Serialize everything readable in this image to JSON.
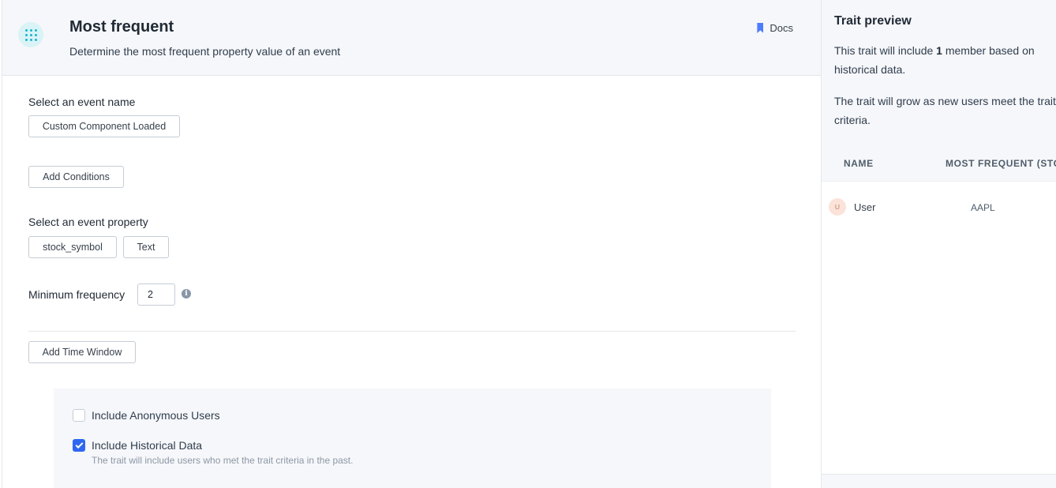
{
  "header": {
    "title": "Most frequent",
    "subtitle": "Determine the most frequent property value of an event",
    "docs_label": "Docs"
  },
  "event_name": {
    "label": "Select an event name",
    "value": "Custom Component Loaded"
  },
  "conditions": {
    "button_label": "Add Conditions"
  },
  "event_property": {
    "label": "Select an event property",
    "property": "stock_symbol",
    "type": "Text"
  },
  "min_frequency": {
    "label": "Minimum frequency",
    "value": "2"
  },
  "time_window": {
    "button_label": "Add Time Window"
  },
  "options": {
    "anonymous": {
      "label": "Include Anonymous Users",
      "checked": false
    },
    "historical": {
      "label": "Include Historical Data",
      "help": "The trait will include users who met the trait criteria in the past.",
      "checked": true
    }
  },
  "preview": {
    "title": "Trait preview",
    "p1_prefix": "This trait will include ",
    "p1_count": "1",
    "p1_suffix": " member based on historical data.",
    "p2": "The trait will grow as new users meet the trait criteria.",
    "columns": [
      "NAME",
      "MOST FREQUENT (STOCK_SYMBOL)"
    ],
    "rows": [
      {
        "avatar": "U",
        "name": "User",
        "value": "AAPL"
      }
    ]
  },
  "colors": {
    "accent": "#2e67f0",
    "icon_teal": "#19b5cb",
    "docs_blue": "#4d7cfe"
  }
}
